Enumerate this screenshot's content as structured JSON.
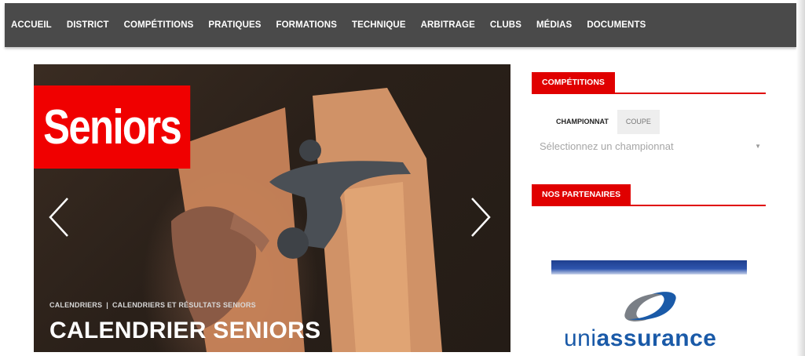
{
  "nav": {
    "items": [
      {
        "label": "ACCUEIL"
      },
      {
        "label": "DISTRICT"
      },
      {
        "label": "COMPÉTITIONS"
      },
      {
        "label": "PRATIQUES"
      },
      {
        "label": "FORMATIONS"
      },
      {
        "label": "TECHNIQUE"
      },
      {
        "label": "ARBITRAGE"
      },
      {
        "label": "CLUBS"
      },
      {
        "label": "MÉDIAS"
      },
      {
        "label": "DOCUMENTS"
      }
    ]
  },
  "slider": {
    "badge": "Seniors",
    "breadcrumb": [
      "CALENDRIERS",
      "CALENDRIERS ET RÉSULTATS SENIORS"
    ],
    "breadcrumb_separator": "|",
    "title": "CALENDRIER SENIORS",
    "prev_icon": "chevron-left-icon",
    "next_icon": "chevron-right-icon"
  },
  "sidebar": {
    "competitions": {
      "heading": "COMPÉTITIONS",
      "tabs": [
        {
          "label": "CHAMPIONNAT",
          "active": true
        },
        {
          "label": "COUPE",
          "active": false
        }
      ],
      "select_placeholder": "Sélectionnez un championnat",
      "select_icon": "caret-down-icon"
    },
    "partners": {
      "heading": "NOS PARTENAIRES",
      "logo_text_1": "uni",
      "logo_text_2": "assurance"
    }
  },
  "colors": {
    "nav_bg": "#4a4a4a",
    "accent_red": "#e00000",
    "badge_red": "#f00000",
    "partner_blue": "#1a5aa8"
  }
}
